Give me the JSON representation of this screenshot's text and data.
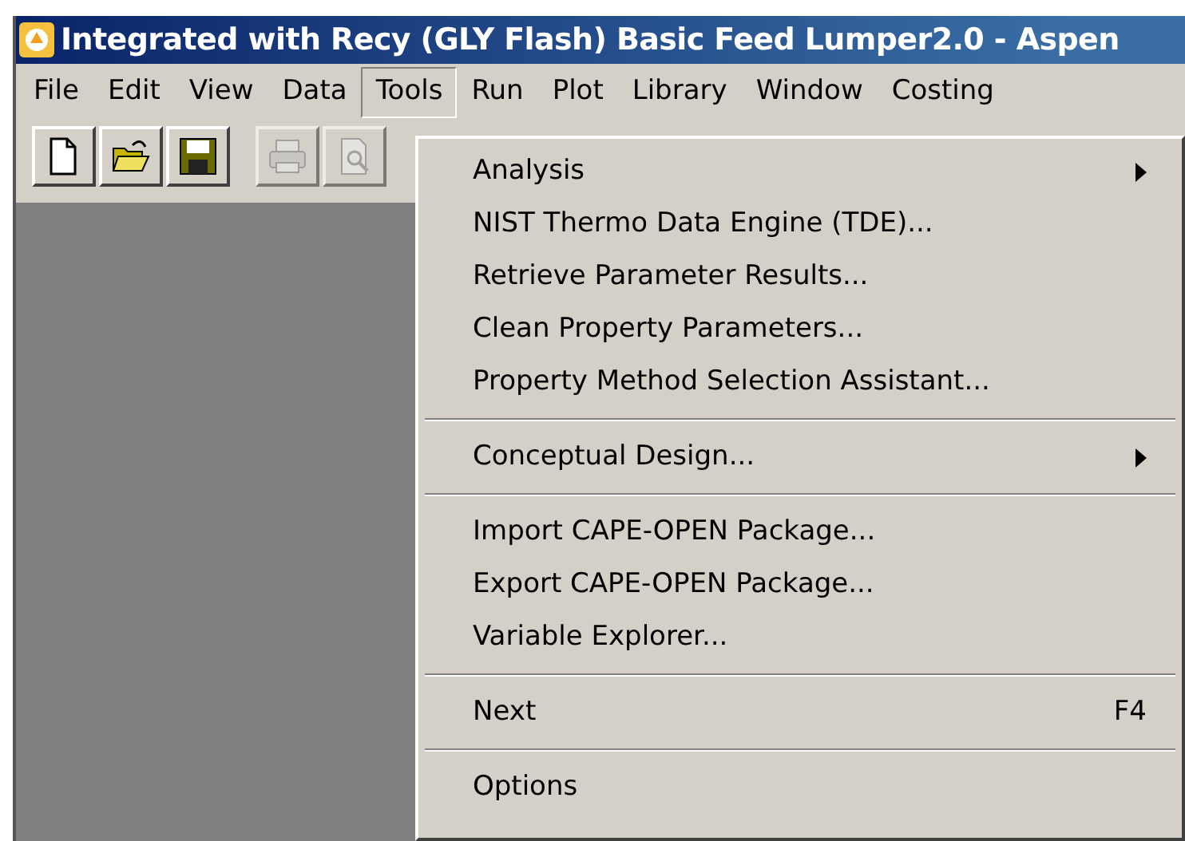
{
  "window": {
    "title": "Integrated with Recy (GLY Flash) Basic Feed Lumper2.0 - Aspen"
  },
  "menubar": [
    {
      "label": "File",
      "selected": false
    },
    {
      "label": "Edit",
      "selected": false
    },
    {
      "label": "View",
      "selected": false
    },
    {
      "label": "Data",
      "selected": false
    },
    {
      "label": "Tools",
      "selected": true
    },
    {
      "label": "Run",
      "selected": false
    },
    {
      "label": "Plot",
      "selected": false
    },
    {
      "label": "Library",
      "selected": false
    },
    {
      "label": "Window",
      "selected": false
    },
    {
      "label": "Costing",
      "selected": false
    }
  ],
  "toolbar": [
    {
      "kind": "new",
      "disabled": false
    },
    {
      "kind": "open",
      "disabled": false
    },
    {
      "kind": "save",
      "disabled": false
    },
    {
      "kind": "gap"
    },
    {
      "kind": "print",
      "disabled": true
    },
    {
      "kind": "preview",
      "disabled": true
    }
  ],
  "tools_menu": [
    {
      "kind": "item",
      "label": "Analysis",
      "submenu": true
    },
    {
      "kind": "item",
      "label": "NIST Thermo Data Engine (TDE)...",
      "submenu": false
    },
    {
      "kind": "item",
      "label": "Retrieve Parameter Results...",
      "submenu": false
    },
    {
      "kind": "item",
      "label": "Clean Property Parameters...",
      "submenu": false
    },
    {
      "kind": "item",
      "label": "Property Method Selection Assistant...",
      "submenu": false
    },
    {
      "kind": "separator"
    },
    {
      "kind": "item",
      "label": "Conceptual Design...",
      "submenu": true
    },
    {
      "kind": "separator"
    },
    {
      "kind": "item",
      "label": "Import CAPE-OPEN Package...",
      "submenu": false
    },
    {
      "kind": "item",
      "label": "Export CAPE-OPEN Package...",
      "submenu": false
    },
    {
      "kind": "item",
      "label": "Variable Explorer...",
      "submenu": false
    },
    {
      "kind": "separator"
    },
    {
      "kind": "item",
      "label": "Next",
      "submenu": false,
      "shortcut": "F4"
    },
    {
      "kind": "separator"
    },
    {
      "kind": "item",
      "label": "Options",
      "submenu": false
    }
  ]
}
